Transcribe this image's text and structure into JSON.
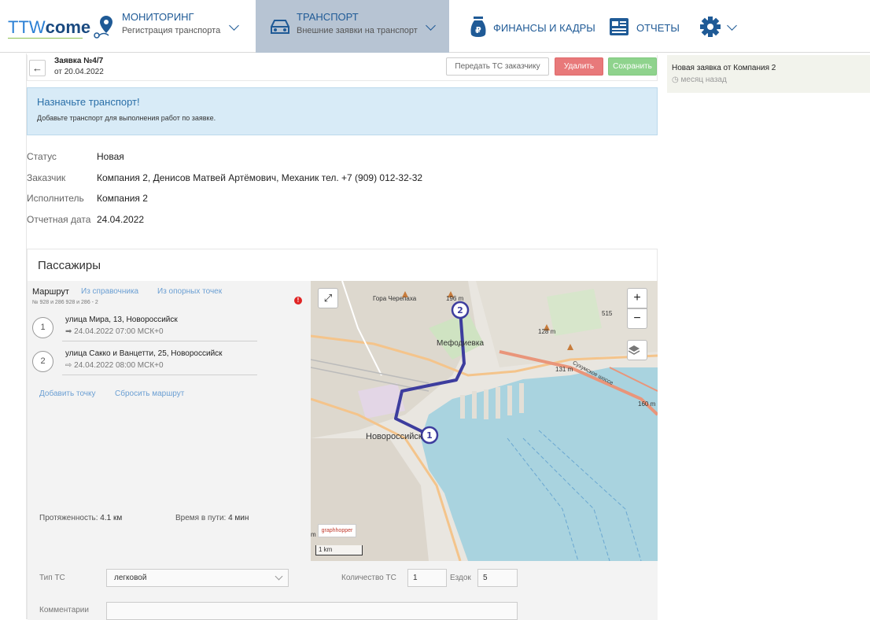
{
  "nav": {
    "logo_part1": "TTW",
    "logo_part2": "come",
    "items": [
      {
        "title": "МОНИТОРИНГ",
        "subtitle": "Регистрация транспорта"
      },
      {
        "title": "ТРАНСПОРТ",
        "subtitle": "Внешние заявки на транспорт"
      },
      {
        "title": "ФИНАНСЫ И КАДРЫ"
      },
      {
        "title": "ОТЧЕТЫ"
      }
    ],
    "icons": [
      "location-pin-icon",
      "car-icon",
      "money-bag-icon",
      "newspaper-icon",
      "gear-icon"
    ],
    "colors": {
      "nav_text": "#1f5a96",
      "active_bg": "#b7c4d3"
    }
  },
  "request": {
    "title": "Заявка №4/7",
    "date": "от 20.04.2022",
    "buttons": {
      "transfer": "Передать ТС заказчику",
      "delete": "Удалить",
      "save": "Сохранить"
    }
  },
  "alert": {
    "title": "Назначьте транспорт!",
    "text": "Добавьте транспорт для выполнения работ по заявке."
  },
  "info": [
    {
      "label": "Статус",
      "value": "Новая"
    },
    {
      "label": "Заказчик",
      "value": "Компания 2, Денисов Матвей Артёмович, Механик тел. +7 (909) 012-32-32"
    },
    {
      "label": "Исполнитель",
      "value": "Компания 2"
    },
    {
      "label": "Отчетная дата",
      "value": "24.04.2022"
    }
  ],
  "passengers": {
    "title": "Пассажиры",
    "route_label": "Маршрут",
    "route_links": [
      "Из справочника",
      "Из опорных точек"
    ],
    "route_sub": "№ 928 и 286 928 и 286 - 2",
    "points": [
      {
        "num": "1",
        "address": "улица Мира, 13, Новороссийск",
        "time": "24.04.2022 07:00 МСК+0",
        "icon": "departure-icon"
      },
      {
        "num": "2",
        "address": "улица Сакко и Ванцетти, 25, Новороссийск",
        "time": "24.04.2022 08:00 МСК+0",
        "icon": "arrival-icon"
      }
    ],
    "actions": [
      "Добавить точку",
      "Сбросить маршрут"
    ],
    "distance_label": "Протяженность:",
    "distance_value": "4.1 км",
    "duration_label": "Время в пути:",
    "duration_value": "4 мин"
  },
  "map": {
    "labels": {
      "gora": "Гора Черепаха",
      "alt1": "196 m",
      "alt2": "128 m",
      "alt3": "131 m",
      "alt4": "515",
      "alt5": "160 m",
      "mefod": "Мефодиевка",
      "city": "Новороссийск",
      "road": "Сухумское шоссе",
      "m": "m"
    },
    "markers": [
      "1",
      "2"
    ],
    "zoom_in": "+",
    "zoom_out": "−",
    "attribution": "graphhopper",
    "scale": "1 km",
    "colors": {
      "route": "#3d3d9e",
      "water": "#a9d3df",
      "land": "#e9e6e0"
    }
  },
  "form": {
    "vehicle_type_label": "Тип ТС",
    "vehicle_type_value": "легковой",
    "vehicle_count_label": "Количество ТС",
    "vehicle_count_value": "1",
    "trips_label": "Ездок",
    "trips_value": "5",
    "comments_label": "Комментарии"
  },
  "notification": {
    "title": "Новая заявка от Компания 2",
    "time": "месяц назад"
  }
}
